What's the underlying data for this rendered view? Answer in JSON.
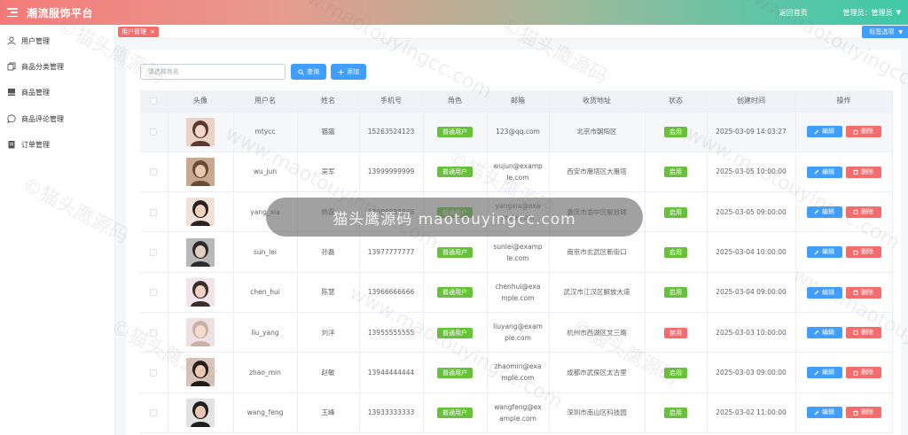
{
  "header": {
    "app_title": "潮流服饰平台",
    "home_link": "返回首页",
    "admin_label": "管理员：管理员",
    "caret": "▼"
  },
  "sidebar": {
    "items": [
      {
        "label": "用户管理",
        "icon": "user-icon"
      },
      {
        "label": "商品分类管理",
        "icon": "copy-icon"
      },
      {
        "label": "商品管理",
        "icon": "goods-icon"
      },
      {
        "label": "商品评论管理",
        "icon": "chat-icon"
      },
      {
        "label": "订单管理",
        "icon": "order-icon"
      }
    ]
  },
  "tabs": {
    "active_label": "用户管理",
    "close": "×",
    "options_label": "标签选项",
    "options_caret": "▼"
  },
  "toolbar": {
    "search_placeholder": "请选择姓名",
    "search_label": "查询",
    "add_label": "添加"
  },
  "table": {
    "headers": [
      "",
      "头像",
      "用户名",
      "姓名",
      "手机号",
      "角色",
      "邮箱",
      "收货地址",
      "状态",
      "创建时间",
      "操作"
    ],
    "edit_label": "编辑",
    "delete_label": "删除",
    "rows": [
      {
        "username": "mtycc",
        "name": "猫猫",
        "phone": "15263524123",
        "role": "普通用户",
        "email": "123@qq.com",
        "address": "北京市朝阳区",
        "status": "启用",
        "status_color": "#67c23a",
        "created": "2025-03-09 14:03:27",
        "avatar_colors": [
          "#e9d3c4",
          "#5a3a2e",
          "#f3d9c9"
        ]
      },
      {
        "username": "wu_jun",
        "name": "吴军",
        "phone": "13999999999",
        "role": "普通用户",
        "email": "wujun@example.com",
        "address": "西安市雁塔区大雁塔",
        "status": "启用",
        "status_color": "#67c23a",
        "created": "2025-03-05 10:00:00",
        "avatar_colors": [
          "#c7a98f",
          "#6b4a35",
          "#e6c9b0"
        ]
      },
      {
        "username": "yang_xia",
        "name": "杨霞",
        "phone": "13988888888",
        "role": "普通用户",
        "email": "yangxia@example.com",
        "address": "重庆市渝中区解放碑",
        "status": "启用",
        "status_color": "#67c23a",
        "created": "2025-03-05 09:00:00",
        "avatar_colors": [
          "#f0e2d6",
          "#2b2320",
          "#f3d2bf"
        ]
      },
      {
        "username": "sun_lei",
        "name": "孙磊",
        "phone": "13977777777",
        "role": "普通用户",
        "email": "sunlei@example.com",
        "address": "南京市玄武区新街口",
        "status": "启用",
        "status_color": "#67c23a",
        "created": "2025-03-04 10:00:00",
        "avatar_colors": [
          "#b8b8b8",
          "#2c2c2c",
          "#e5cfc0"
        ]
      },
      {
        "username": "chen_hui",
        "name": "陈慧",
        "phone": "13966666666",
        "role": "普通用户",
        "email": "chenhui@example.com",
        "address": "武汉市江汉区解放大道",
        "status": "启用",
        "status_color": "#67c23a",
        "created": "2025-03-04 09:00:00",
        "avatar_colors": [
          "#f1e4ea",
          "#3a2d2a",
          "#f2d3c3"
        ]
      },
      {
        "username": "liu_yang",
        "name": "刘洋",
        "phone": "13955555555",
        "role": "普通用户",
        "email": "liuyang@example.com",
        "address": "杭州市西湖区文三路",
        "status": "禁用",
        "status_color": "#f56c6c",
        "created": "2025-03-03 10:00:00",
        "avatar_colors": [
          "#efe0e2",
          "#c9b0a6",
          "#f6dccf"
        ]
      },
      {
        "username": "zhao_min",
        "name": "赵敏",
        "phone": "13944444444",
        "role": "普通用户",
        "email": "zhaomin@example.com",
        "address": "成都市武侯区太古里",
        "status": "启用",
        "status_color": "#67c23a",
        "created": "2025-03-03 09:00:00",
        "avatar_colors": [
          "#d8c3b8",
          "#221a17",
          "#f0cdb8"
        ]
      },
      {
        "username": "wang_feng",
        "name": "王峰",
        "phone": "13933333333",
        "role": "普通用户",
        "email": "wangfeng@example.com",
        "address": "深圳市南山区科技园",
        "status": "启用",
        "status_color": "#67c23a",
        "created": "2025-03-02 11:00:00",
        "avatar_colors": [
          "#e2e2e2",
          "#1e1e1e",
          "#e8c7b1"
        ]
      }
    ]
  },
  "watermark": {
    "text": "©猫头鹰源码",
    "url": "www.maotouyingcc.com",
    "toast": "猫头鹰源码 maotouyingcc.com"
  }
}
